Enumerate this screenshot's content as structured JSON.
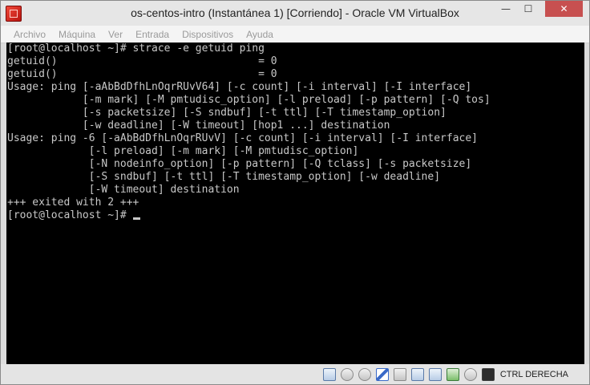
{
  "window": {
    "title": "os-centos-intro (Instantánea 1) [Corriendo] - Oracle VM VirtualBox",
    "controls": {
      "minimize": "—",
      "maximize": "☐",
      "close": "✕"
    }
  },
  "menu": [
    "Archivo",
    "Máquina",
    "Ver",
    "Entrada",
    "Dispositivos",
    "Ayuda"
  ],
  "terminal": {
    "lines": [
      "[root@localhost ~]# strace -e getuid ping",
      "getuid()                                = 0",
      "getuid()                                = 0",
      "Usage: ping [-aAbBdDfhLnOqrRUvV64] [-c count] [-i interval] [-I interface]",
      "            [-m mark] [-M pmtudisc_option] [-l preload] [-p pattern] [-Q tos]",
      "            [-s packetsize] [-S sndbuf] [-t ttl] [-T timestamp_option]",
      "            [-w deadline] [-W timeout] [hop1 ...] destination",
      "Usage: ping -6 [-aAbBdDfhLnOqrRUvV] [-c count] [-i interval] [-I interface]",
      "             [-l preload] [-m mark] [-M pmtudisc_option]",
      "             [-N nodeinfo_option] [-p pattern] [-Q tclass] [-s packetsize]",
      "             [-S sndbuf] [-t ttl] [-T timestamp_option] [-w deadline]",
      "             [-W timeout] destination",
      "+++ exited with 2 +++"
    ],
    "prompt": "[root@localhost ~]# "
  },
  "status": {
    "icons": [
      "hard-disk-icon",
      "optical-drive-icon",
      "audio-icon",
      "pen-icon",
      "folder-icon",
      "display-icon",
      "network-icon",
      "usb-icon",
      "cd-icon",
      "mouse-capture-icon"
    ],
    "host_key": "CTRL DERECHA"
  },
  "colors": {
    "terminal_bg": "#000000",
    "terminal_fg": "#c8c8c8",
    "close_button": "#c75050"
  }
}
